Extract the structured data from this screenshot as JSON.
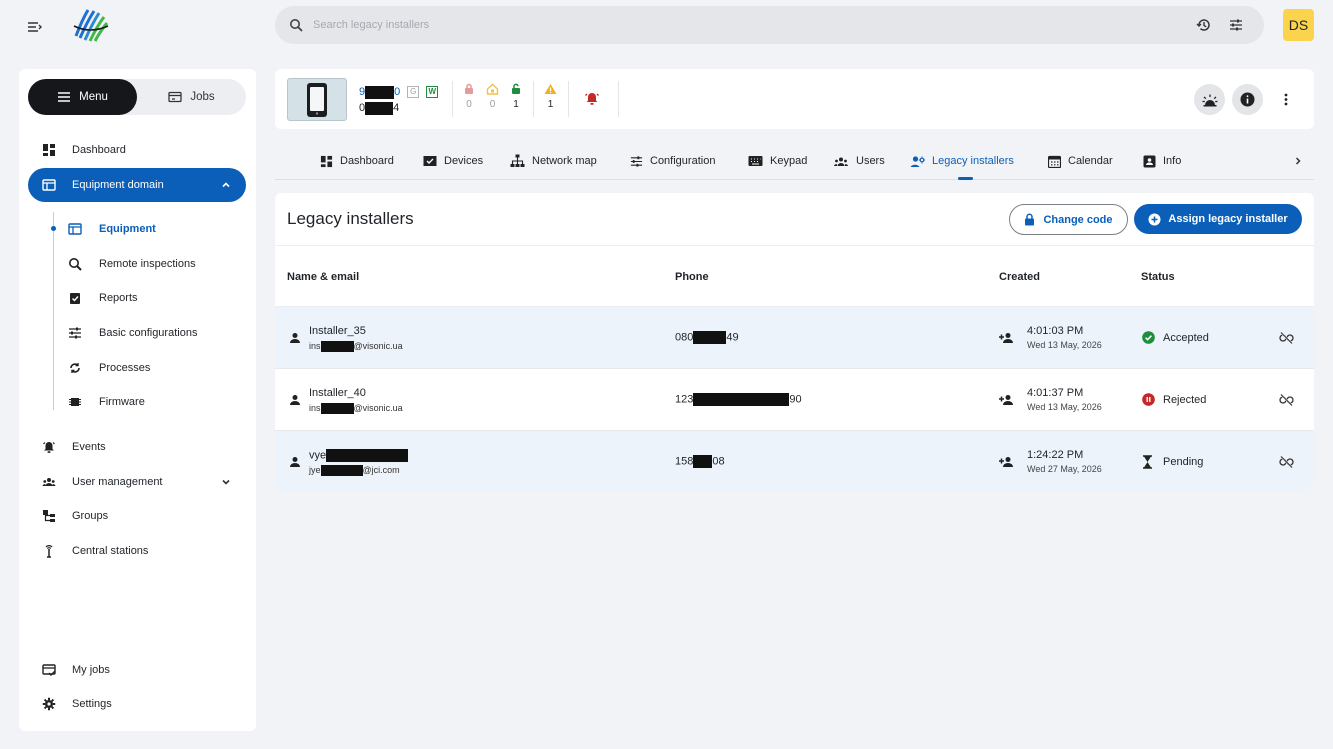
{
  "header": {
    "search_placeholder": "Search legacy installers",
    "avatar_initials": "DS",
    "brand_colors": [
      "#1d6fd0",
      "#45b649",
      "#0b5fb8"
    ]
  },
  "sidebar": {
    "segments": {
      "menu": "Menu",
      "jobs": "Jobs"
    },
    "items": {
      "dashboard": "Dashboard",
      "equipment_domain": "Equipment domain",
      "events": "Events",
      "user_management": "User management",
      "groups": "Groups",
      "central_stations": "Central stations",
      "my_jobs": "My jobs",
      "settings": "Settings"
    },
    "sub_items": {
      "equipment": "Equipment",
      "remote_inspections": "Remote inspections",
      "reports": "Reports",
      "basic_configurations": "Basic configurations",
      "processes": "Processes",
      "firmware": "Firmware"
    }
  },
  "device": {
    "id_prefix": "9",
    "id_suffix": "0",
    "code_prefix": "0",
    "code_suffix": "4",
    "tag_g": "G",
    "tag_w": "W",
    "stats": {
      "locked_red": "0",
      "home": "0",
      "unlocked": "1",
      "warning": "1"
    }
  },
  "tabs": {
    "dashboard": "Dashboard",
    "devices": "Devices",
    "network_map": "Network map",
    "configuration": "Configuration",
    "keypad": "Keypad",
    "users": "Users",
    "legacy_installers": "Legacy installers",
    "calendar": "Calendar",
    "info": "Info"
  },
  "panel": {
    "title": "Legacy installers",
    "change_code": "Change code",
    "assign": "Assign legacy installer",
    "columns": {
      "name": "Name & email",
      "phone": "Phone",
      "created": "Created",
      "status": "Status"
    },
    "rows": [
      {
        "name": "Installer_35",
        "email_prefix": "ins",
        "email_suffix": "@visonic.ua",
        "phone_prefix": "080",
        "phone_suffix": "49",
        "time": "4:01:03 PM",
        "date": "Wed 13 May, 2026",
        "status": "Accepted"
      },
      {
        "name": "Installer_40",
        "email_prefix": "ins",
        "email_suffix": "@visonic.ua",
        "phone_prefix": "123",
        "phone_suffix": "90",
        "time": "4:01:37 PM",
        "date": "Wed 13 May, 2026",
        "status": "Rejected"
      },
      {
        "name": "vye",
        "email_prefix": "jye",
        "email_suffix": "@jci.com",
        "phone_prefix": "158",
        "phone_suffix": "08",
        "time": "1:24:22 PM",
        "date": "Wed 27 May, 2026",
        "status": "Pending"
      }
    ]
  }
}
